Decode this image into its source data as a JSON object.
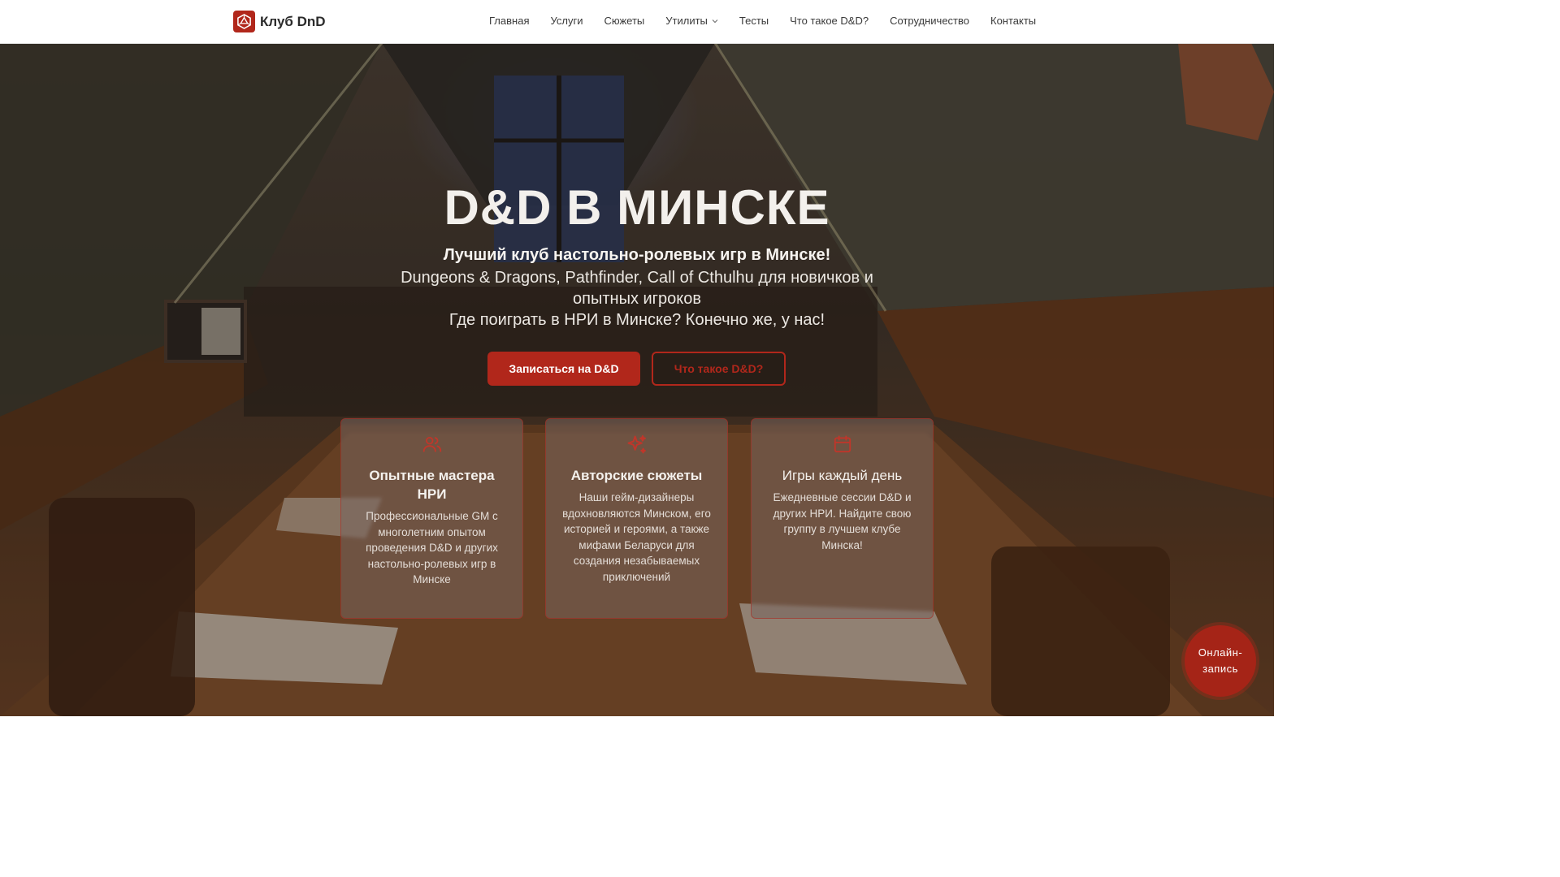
{
  "header": {
    "logo_text": "Клуб DnD",
    "nav": [
      {
        "label": "Главная"
      },
      {
        "label": "Услуги"
      },
      {
        "label": "Сюжеты"
      },
      {
        "label": "Утилиты",
        "has_dropdown": true
      },
      {
        "label": "Тесты"
      },
      {
        "label": "Что такое D&D?"
      },
      {
        "label": "Сотрудничество"
      },
      {
        "label": "Контакты"
      }
    ]
  },
  "hero": {
    "title": "D&D В МИНСКЕ",
    "subtitle": "Лучший клуб настольно-ролевых игр в Минске!",
    "description": "Dungeons & Dragons, Pathfinder, Call of Cthulhu для новичков и опытных игроков",
    "question": "Где поиграть в НРИ в Минске? Конечно же, у нас!",
    "primary_button": "Записаться на D&D",
    "secondary_button": "Что такое D&D?"
  },
  "features": [
    {
      "icon": "users-icon",
      "title": "Опытные мастера НРИ",
      "text": "Профессиональные GM с многолетним опытом проведения D&D и других настольно-ролевых игр в Минске"
    },
    {
      "icon": "sparkles-icon",
      "title": "Авторские сюжеты",
      "text": "Наши гейм-дизайнеры вдохновляются Минском, его историей и героями, а также мифами Беларуси для создания незабываемых приключений"
    },
    {
      "icon": "calendar-icon",
      "title": "Игры каждый день",
      "text": "Ежедневные сессии D&D и других НРИ. Найдите свою группу в лучшем клубе Минска!"
    }
  ],
  "online_booking": {
    "line1": "Онлайн-",
    "line2": "запись"
  },
  "colors": {
    "accent": "#b1271b",
    "header_bg": "#ffffff",
    "nav_text": "#3a3a3a"
  }
}
